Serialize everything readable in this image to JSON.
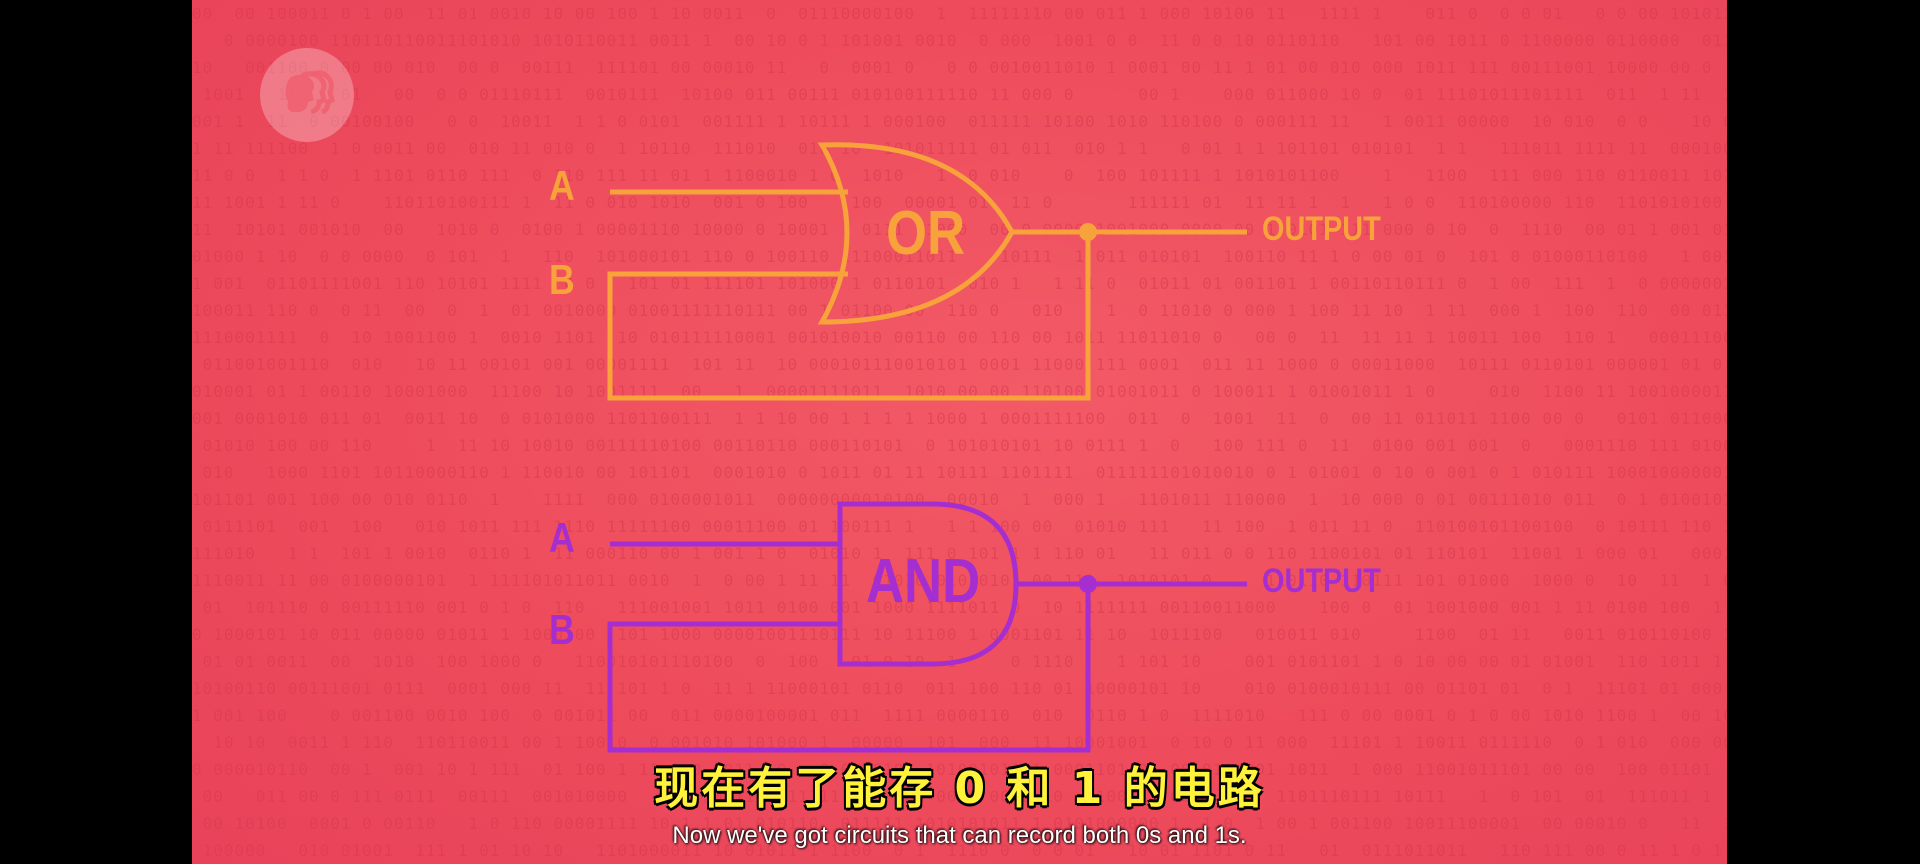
{
  "colors": {
    "background": "#ef4f5f",
    "or_gate": "#f7a23a",
    "and_gate": "#a52ed0",
    "subtitle_zh": "#fff23a"
  },
  "logo": {
    "icon": "pbs-logo-icon"
  },
  "or_circuit": {
    "input_a": "A",
    "input_b": "B",
    "gate_label": "OR",
    "output_label": "OUTPUT"
  },
  "and_circuit": {
    "input_a": "A",
    "input_b": "B",
    "gate_label": "AND",
    "output_label": "OUTPUT"
  },
  "subtitles": {
    "chinese": "现在有了能存 0 和 1 的电路",
    "english": "Now we've got circuits that can record both 0s and 1s."
  }
}
